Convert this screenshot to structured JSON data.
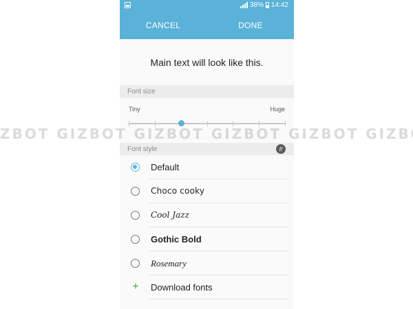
{
  "status_bar": {
    "battery_text": "38%",
    "time": "14:42"
  },
  "action_bar": {
    "cancel_label": "CANCEL",
    "done_label": "DONE"
  },
  "preview": {
    "text": "Main text will look like this."
  },
  "font_size": {
    "header": "Font size",
    "min_label": "Tiny",
    "max_label": "Huge",
    "steps": 7,
    "selected_step": 2
  },
  "font_style": {
    "header": "Font style",
    "badge_icon": "font-download-icon",
    "options": [
      {
        "label": "Default",
        "selected": true
      },
      {
        "label": "Choco cooky",
        "selected": false
      },
      {
        "label": "Cool Jazz",
        "selected": false
      },
      {
        "label": "Gothic Bold",
        "selected": false
      },
      {
        "label": "Rosemary",
        "selected": false
      }
    ],
    "download_label": "Download fonts"
  },
  "watermark": {
    "text": "ZBOT GIZBOT GIZBOT GIZBOT GIZBOT GIZBOT GIZBOT"
  },
  "colors": {
    "accent": "#5ab2d8",
    "plus": "#3daa3d"
  }
}
